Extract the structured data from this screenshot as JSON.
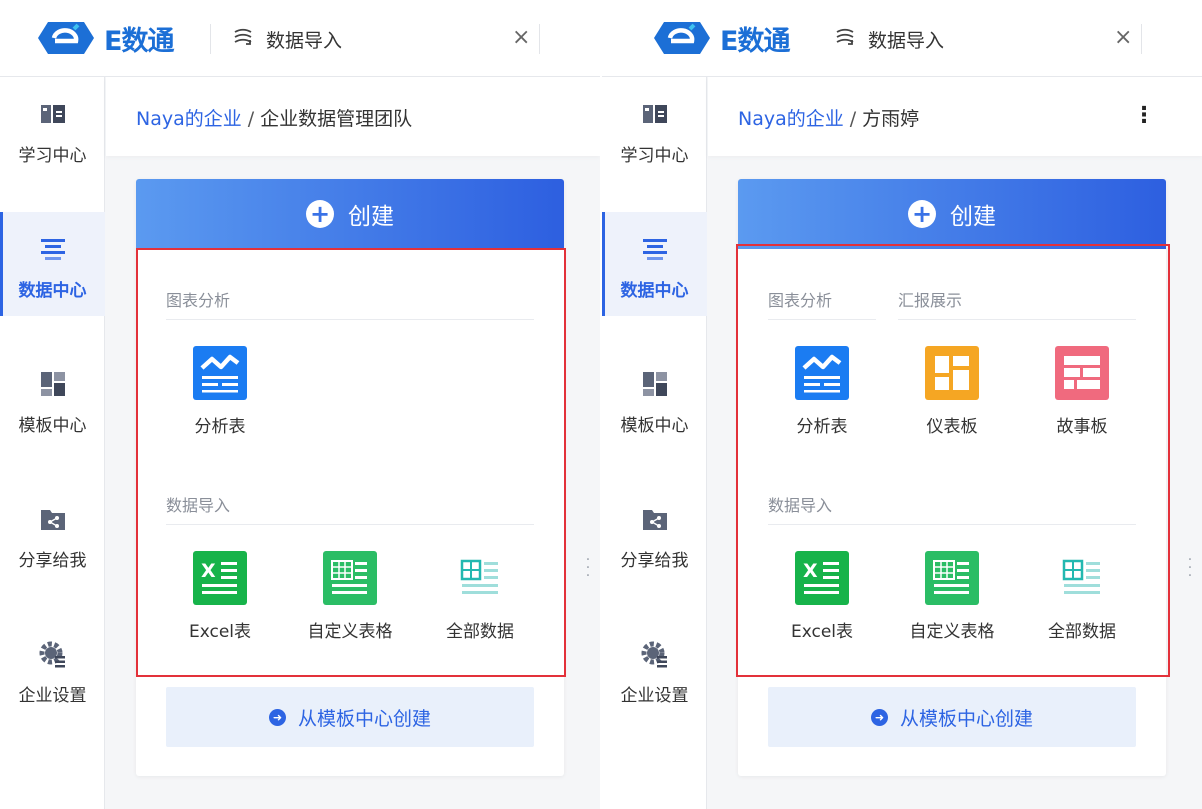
{
  "app": {
    "logo_text": "E数通",
    "brand_color": "#1c6fd6",
    "accent": "#2d64e3"
  },
  "tab": {
    "title": "数据导入",
    "icon": "data-import-icon",
    "close": "×"
  },
  "sidebar": {
    "items": [
      {
        "label": "学习中心",
        "icon": "book-icon"
      },
      {
        "label": "数据中心",
        "icon": "data-list-icon",
        "active": true
      },
      {
        "label": "模板中心",
        "icon": "template-grid-icon"
      },
      {
        "label": "分享给我",
        "icon": "share-folder-icon"
      },
      {
        "label": "企业设置",
        "icon": "gear-icon"
      }
    ]
  },
  "left": {
    "breadcrumb": {
      "root": "Naya的企业",
      "sep": "/",
      "current": "企业数据管理团队"
    },
    "create_label": "创建",
    "sections": {
      "chart_analysis": "图表分析",
      "data_import": "数据导入"
    },
    "chart_tiles": [
      {
        "label": "分析表",
        "icon": "analysis-table-icon"
      }
    ],
    "import_tiles": [
      {
        "label": "Excel表",
        "icon": "excel-icon"
      },
      {
        "label": "自定义表格",
        "icon": "custom-table-icon"
      },
      {
        "label": "全部数据",
        "icon": "all-data-icon"
      }
    ],
    "template_create_label": "从模板中心创建"
  },
  "right": {
    "breadcrumb": {
      "root": "Naya的企业",
      "sep": "/",
      "current": "方雨婷"
    },
    "more": "⋮",
    "create_label": "创建",
    "sections": {
      "chart_analysis": "图表分析",
      "report_display": "汇报展示",
      "data_import": "数据导入"
    },
    "chart_tiles": [
      {
        "label": "分析表",
        "icon": "analysis-table-icon"
      },
      {
        "label": "仪表板",
        "icon": "dashboard-icon"
      },
      {
        "label": "故事板",
        "icon": "storyboard-icon"
      }
    ],
    "import_tiles": [
      {
        "label": "Excel表",
        "icon": "excel-icon"
      },
      {
        "label": "自定义表格",
        "icon": "custom-table-icon"
      },
      {
        "label": "全部数据",
        "icon": "all-data-icon"
      }
    ],
    "template_create_label": "从模板中心创建"
  }
}
